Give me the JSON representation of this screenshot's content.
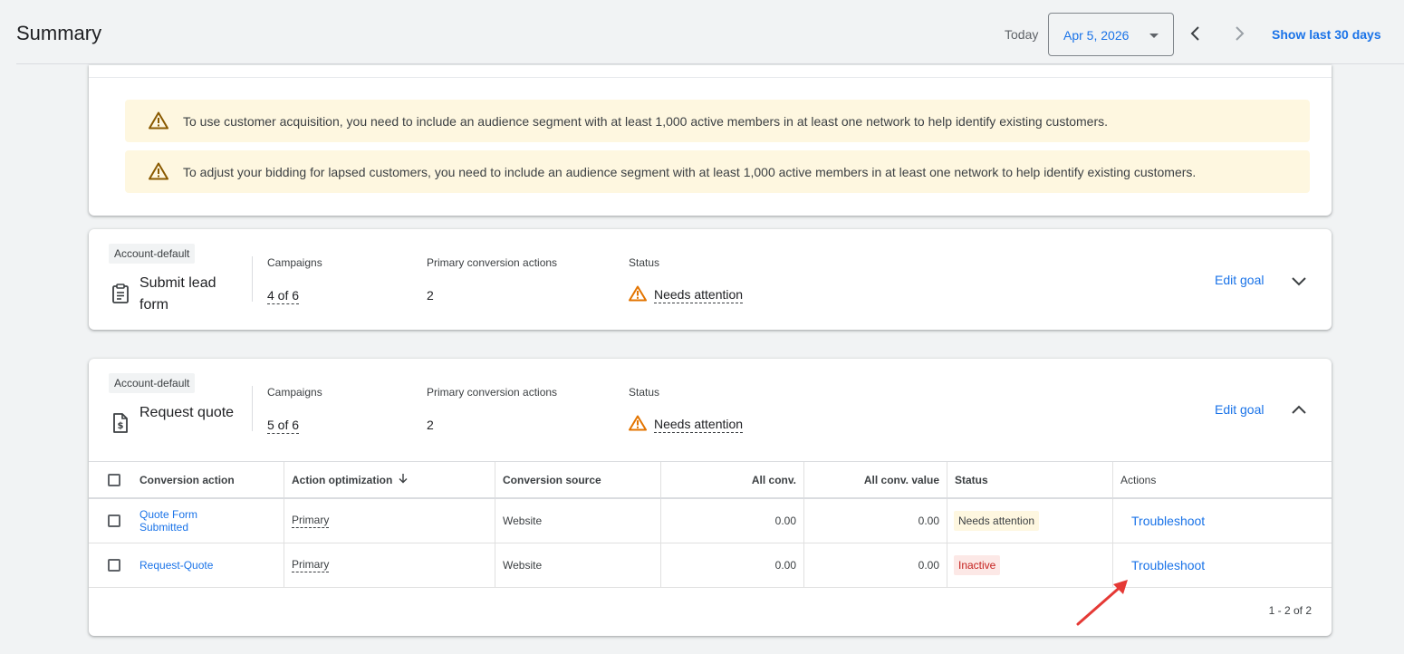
{
  "header": {
    "title": "Summary",
    "today_label": "Today",
    "date_value": "Apr 5, 2026",
    "show_last_label": "Show last 30 days"
  },
  "warnings": [
    "To use customer acquisition, you need to include an audience segment with at least 1,000 active members in at least one network to help identify existing customers.",
    "To adjust your bidding for lapsed customers, you need to include an audience segment with at least 1,000 active members in at least one network to help identify existing customers."
  ],
  "goals": [
    {
      "chip": "Account-default",
      "name": "Submit lead form",
      "campaigns_label": "Campaigns",
      "campaigns_value": "4 of 6",
      "primary_label": "Primary conversion actions",
      "primary_value": "2",
      "status_label": "Status",
      "status_value": "Needs attention",
      "edit_label": "Edit goal"
    },
    {
      "chip": "Account-default",
      "name": "Request quote",
      "campaigns_label": "Campaigns",
      "campaigns_value": "5 of 6",
      "primary_label": "Primary conversion actions",
      "primary_value": "2",
      "status_label": "Status",
      "status_value": "Needs attention",
      "edit_label": "Edit goal"
    }
  ],
  "table": {
    "headers": {
      "conversion_action": "Conversion action",
      "action_optimization": "Action optimization",
      "conversion_source": "Conversion source",
      "all_conv": "All conv.",
      "all_conv_value": "All conv. value",
      "status": "Status",
      "actions": "Actions"
    },
    "rows": [
      {
        "conversion_action": "Quote Form Submitted",
        "action_optimization": "Primary",
        "conversion_source": "Website",
        "all_conv": "0.00",
        "all_conv_value": "0.00",
        "status": "Needs attention",
        "action": "Troubleshoot"
      },
      {
        "conversion_action": "Request-Quote",
        "action_optimization": "Primary",
        "conversion_source": "Website",
        "all_conv": "0.00",
        "all_conv_value": "0.00",
        "status": "Inactive",
        "action": "Troubleshoot"
      }
    ],
    "pagination": "1 - 2 of 2"
  },
  "colors": {
    "accent": "#1a73e8",
    "warning_bg": "#fef7e0",
    "warning_icon": "#b06000",
    "inactive_bg": "#fce8e6",
    "inactive_text": "#c5221f",
    "annotation_arrow": "#e53935"
  }
}
